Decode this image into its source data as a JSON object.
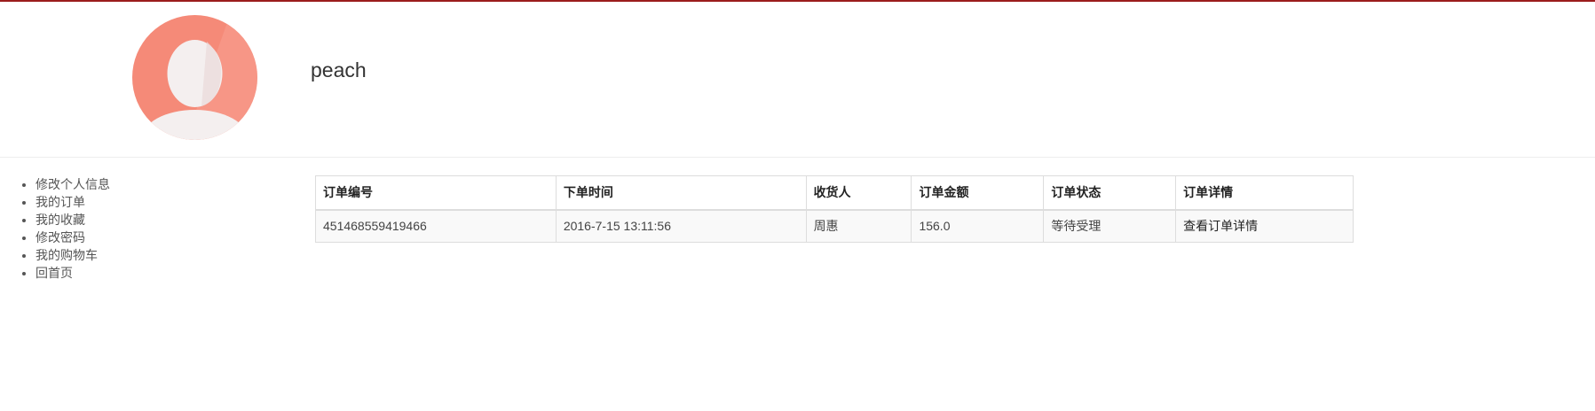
{
  "user": {
    "name": "peach"
  },
  "sidebar": {
    "items": [
      {
        "label": "修改个人信息"
      },
      {
        "label": "我的订单"
      },
      {
        "label": "我的收藏"
      },
      {
        "label": "修改密码"
      },
      {
        "label": "我的购物车"
      },
      {
        "label": "回首页"
      }
    ]
  },
  "orders": {
    "headers": [
      "订单编号",
      "下单时间",
      "收货人",
      "订单金额",
      "订单状态",
      "订单详情"
    ],
    "rows": [
      {
        "id": "451468559419466",
        "time": "2016-7-15 13:11:56",
        "receiver": "周惠",
        "amount": "156.0",
        "status": "等待受理",
        "detail": "查看订单详情"
      }
    ]
  },
  "colors": {
    "accent": "#9b1c1c",
    "avatar": "#f58a78"
  },
  "icons": {
    "avatar": "user-avatar-icon"
  }
}
